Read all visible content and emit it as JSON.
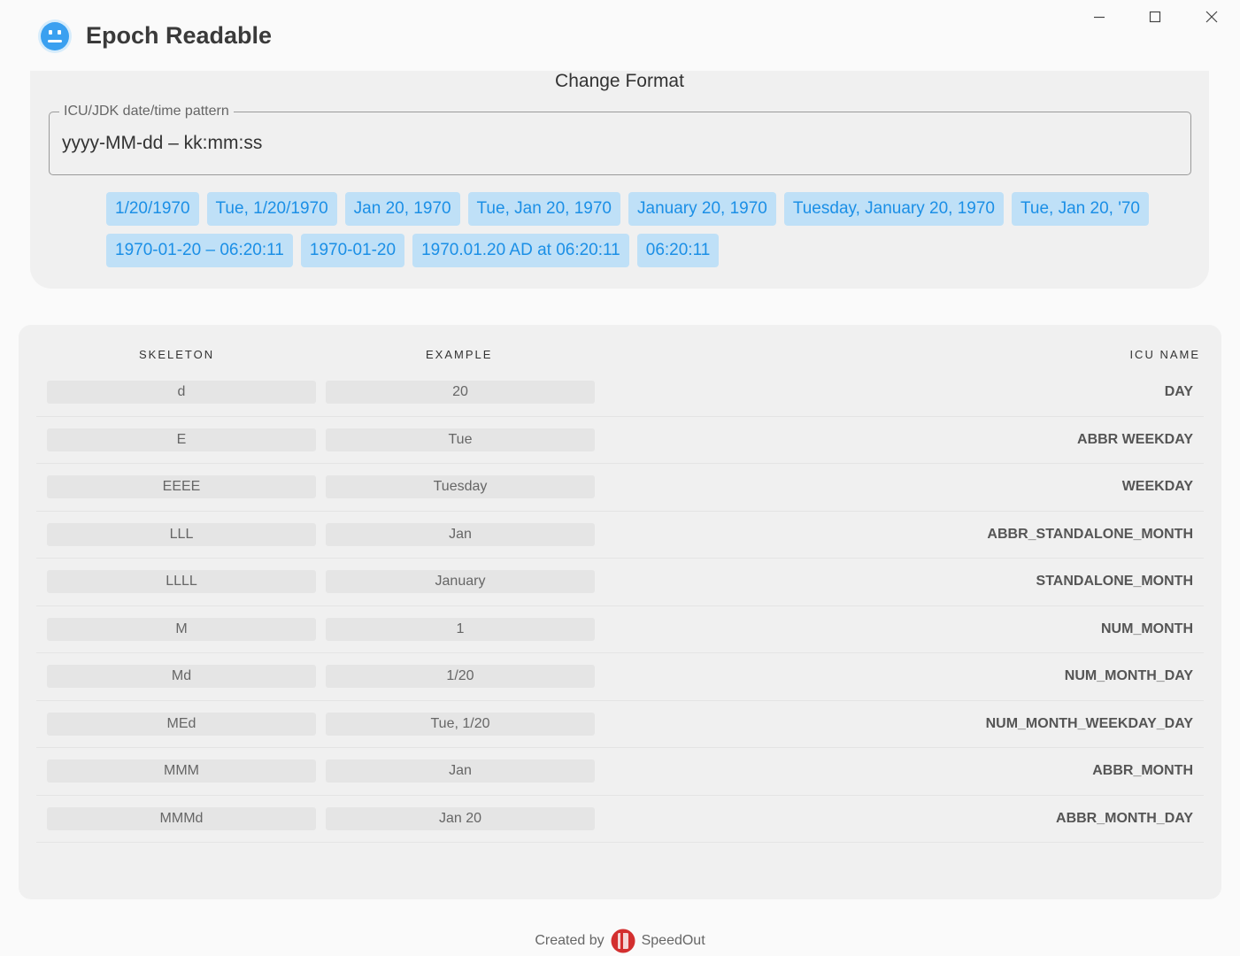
{
  "app": {
    "title": "Epoch Readable"
  },
  "format": {
    "title": "Change Format",
    "pattern_label": "ICU/JDK date/time pattern",
    "pattern_value": "yyyy-MM-dd – kk:mm:ss",
    "chip_rows": [
      [
        "1/20/1970",
        "Tue, 1/20/1970",
        "Jan 20, 1970",
        "Tue, Jan 20, 1970",
        "January 20, 1970",
        "Tuesday, January 20, 1970",
        "Tue, Jan 20, '70"
      ],
      [
        "1970-01-20 – 06:20:11",
        "1970-01-20",
        "1970.01.20 AD at 06:20:11",
        "06:20:11"
      ]
    ]
  },
  "table": {
    "headers": {
      "skeleton": "SKELETON",
      "example": "EXAMPLE",
      "icu_name": "ICU NAME"
    },
    "rows": [
      {
        "skeleton": "d",
        "example": "20",
        "icu_name": "DAY"
      },
      {
        "skeleton": "E",
        "example": "Tue",
        "icu_name": "ABBR WEEKDAY"
      },
      {
        "skeleton": "EEEE",
        "example": "Tuesday",
        "icu_name": "WEEKDAY"
      },
      {
        "skeleton": "LLL",
        "example": "Jan",
        "icu_name": "ABBR_STANDALONE_MONTH"
      },
      {
        "skeleton": "LLLL",
        "example": "January",
        "icu_name": "STANDALONE_MONTH"
      },
      {
        "skeleton": "M",
        "example": "1",
        "icu_name": "NUM_MONTH"
      },
      {
        "skeleton": "Md",
        "example": "1/20",
        "icu_name": "NUM_MONTH_DAY"
      },
      {
        "skeleton": "MEd",
        "example": "Tue, 1/20",
        "icu_name": "NUM_MONTH_WEEKDAY_DAY"
      },
      {
        "skeleton": "MMM",
        "example": "Jan",
        "icu_name": "ABBR_MONTH"
      },
      {
        "skeleton": "MMMd",
        "example": "Jan 20",
        "icu_name": "ABBR_MONTH_DAY"
      }
    ]
  },
  "footer": {
    "created_by": "Created by",
    "brand": "SpeedOut"
  },
  "colors": {
    "accent": "#1b8fe6",
    "chip_bg": "#bfe0f7",
    "logo_red": "#d32f2f",
    "app_icon": "#3aa0f0"
  },
  "icons": {
    "app": "robot-face-icon",
    "brand": "speedout-logo-icon",
    "minimize": "minimize-icon",
    "maximize": "maximize-icon",
    "close": "close-icon"
  }
}
